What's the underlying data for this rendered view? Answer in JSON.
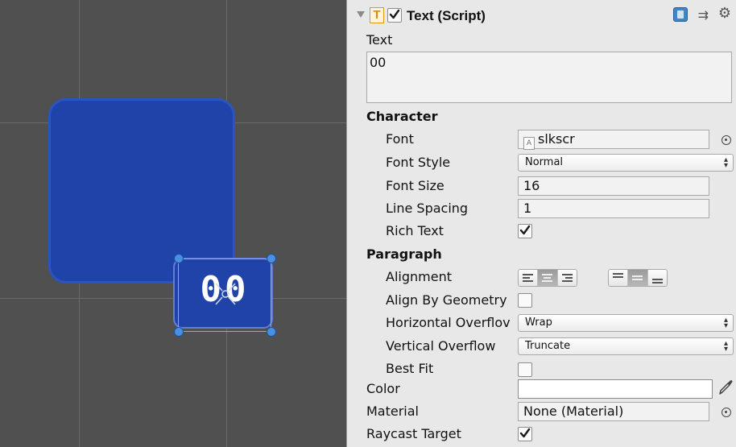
{
  "scene": {
    "label_text": "00"
  },
  "inspector": {
    "component_title": "Text (Script)",
    "component_enabled": true,
    "text_label": "Text",
    "text_value": "00",
    "character": {
      "heading": "Character",
      "font_label": "Font",
      "font_value": "slkscr",
      "font_style_label": "Font Style",
      "font_style_value": "Normal",
      "font_size_label": "Font Size",
      "font_size_value": "16",
      "line_spacing_label": "Line Spacing",
      "line_spacing_value": "1",
      "rich_text_label": "Rich Text",
      "rich_text_checked": true
    },
    "paragraph": {
      "heading": "Paragraph",
      "alignment_label": "Alignment",
      "horizontal_alignment_selected": "center",
      "vertical_alignment_selected": "middle",
      "align_by_geometry_label": "Align By Geometry",
      "align_by_geometry_checked": false,
      "horizontal_overflow_label": "Horizontal Overflov",
      "horizontal_overflow_value": "Wrap",
      "vertical_overflow_label": "Vertical Overflow",
      "vertical_overflow_value": "Truncate",
      "best_fit_label": "Best Fit",
      "best_fit_checked": false
    },
    "color_label": "Color",
    "color_value": "#ffffff",
    "material_label": "Material",
    "material_value": "None (Material)",
    "raycast_target_label": "Raycast Target",
    "raycast_target_checked": true,
    "icons": {
      "component_type": "text-component-icon",
      "help": "help-book-icon",
      "presets": "presets-icon",
      "settings": "gear-icon",
      "color_picker": "eyedropper-icon",
      "object_picker": "object-picker-icon"
    }
  }
}
